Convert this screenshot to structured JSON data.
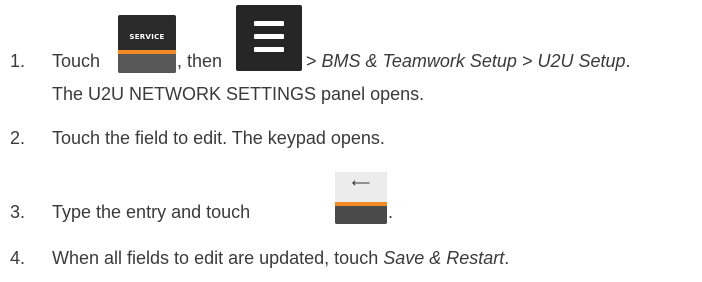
{
  "steps": [
    {
      "number": "1.",
      "text_a": "Touch",
      "text_b": ", then",
      "text_c": " > ",
      "text_d": "BMS & Teamwork Setup > U2U Setup",
      "text_e": ".",
      "line2": "The U2U NETWORK SETTINGS panel opens."
    },
    {
      "number": "2.",
      "text": "Touch the field to edit. The keypad opens."
    },
    {
      "number": "3.",
      "text_a": "Type the entry and touch",
      "text_b": "."
    },
    {
      "number": "4.",
      "text_a": "When all fields to edit are updated, touch ",
      "text_b": "Save & Restart",
      "text_c": "."
    }
  ],
  "icons": {
    "service": {
      "name": "service-button-icon",
      "label": "SERVICE"
    },
    "menu": {
      "name": "hamburger-menu-icon"
    },
    "enter": {
      "name": "enter-key-icon",
      "glyph": "⟵"
    }
  },
  "colors": {
    "accent": "#f38b24",
    "icon_dark": "#262626",
    "text": "#3a3a3a"
  }
}
